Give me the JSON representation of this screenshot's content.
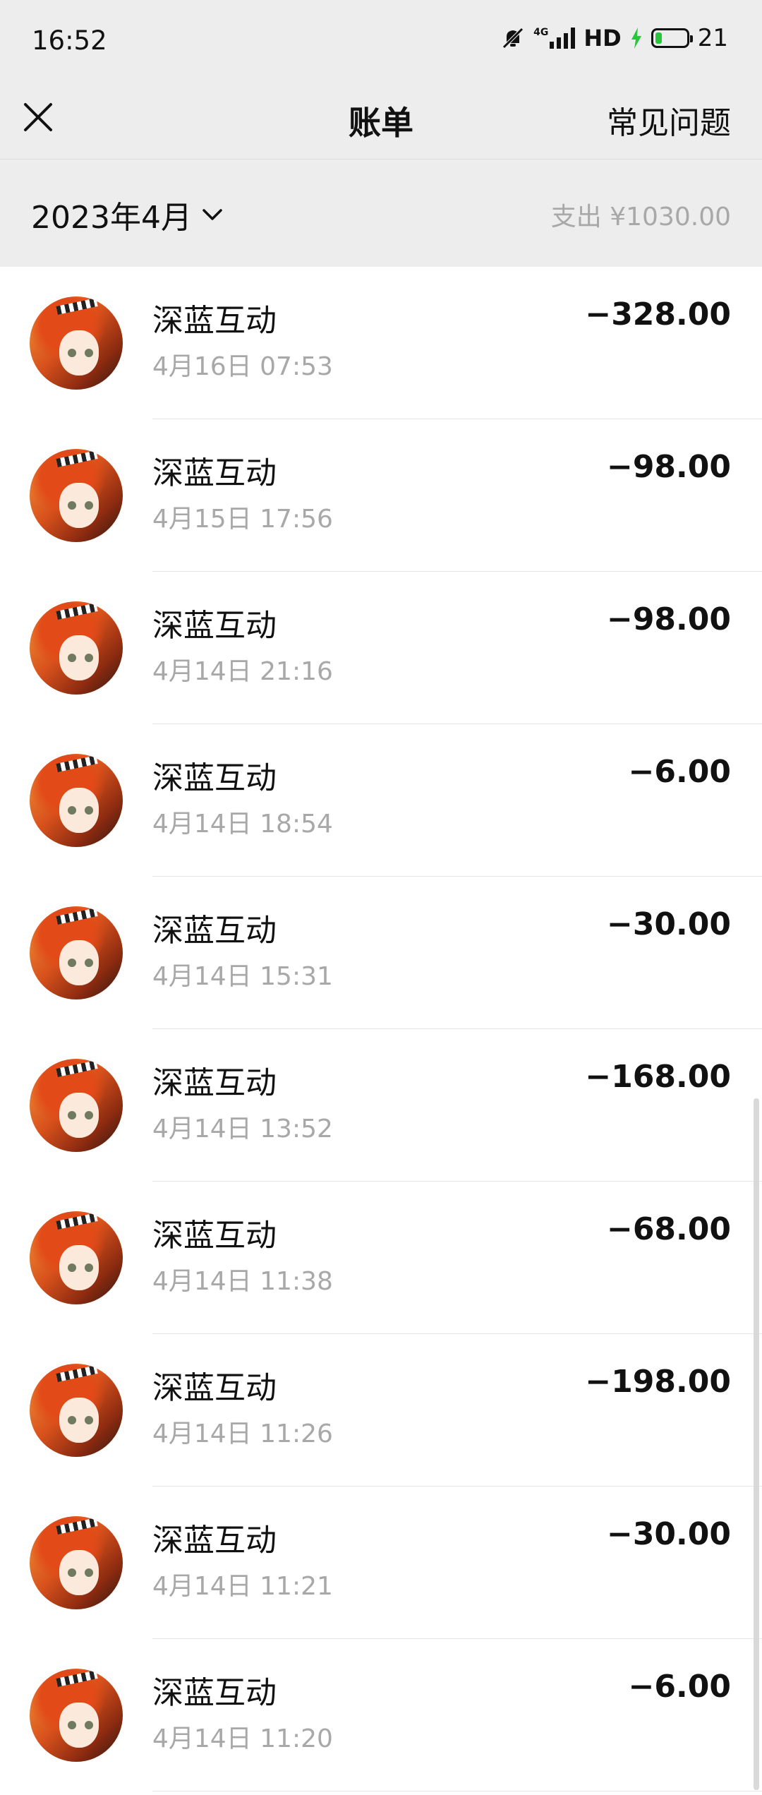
{
  "status_bar": {
    "time": "16:52",
    "network": "4G",
    "hd": "HD",
    "battery_level": "21",
    "icons": [
      "mute-icon",
      "signal-icon",
      "charging-icon",
      "battery-icon"
    ],
    "battery_fill_color": "#26c73a"
  },
  "nav": {
    "title": "账单",
    "faq": "常见问题",
    "close_icon": "close-icon"
  },
  "month_bar": {
    "month": "2023年4月",
    "total": "支出 ¥1030.00",
    "dropdown_icon": "chevron-down-icon"
  },
  "transactions": [
    {
      "merchant": "深蓝互动",
      "date": "4月16日 07:53",
      "amount": "−328.00"
    },
    {
      "merchant": "深蓝互动",
      "date": "4月15日 17:56",
      "amount": "−98.00"
    },
    {
      "merchant": "深蓝互动",
      "date": "4月14日 21:16",
      "amount": "−98.00"
    },
    {
      "merchant": "深蓝互动",
      "date": "4月14日 18:54",
      "amount": "−6.00"
    },
    {
      "merchant": "深蓝互动",
      "date": "4月14日 15:31",
      "amount": "−30.00"
    },
    {
      "merchant": "深蓝互动",
      "date": "4月14日 13:52",
      "amount": "−168.00"
    },
    {
      "merchant": "深蓝互动",
      "date": "4月14日 11:38",
      "amount": "−68.00"
    },
    {
      "merchant": "深蓝互动",
      "date": "4月14日 11:26",
      "amount": "−198.00"
    },
    {
      "merchant": "深蓝互动",
      "date": "4月14日 11:21",
      "amount": "−30.00"
    },
    {
      "merchant": "深蓝互动",
      "date": "4月14日 11:20",
      "amount": "−6.00"
    }
  ],
  "colors": {
    "header_bg": "#ededed",
    "secondary_text": "#a8a8a8",
    "primary_text": "#111111"
  }
}
